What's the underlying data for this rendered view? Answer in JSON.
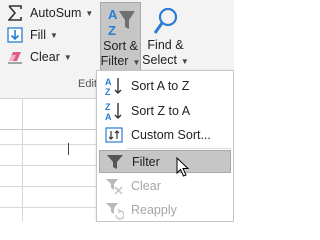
{
  "ribbon": {
    "autosum": {
      "label": "AutoSum",
      "icon": "sigma-icon"
    },
    "fill": {
      "label": "Fill",
      "icon": "fill-down-icon"
    },
    "clear": {
      "label": "Clear",
      "icon": "eraser-icon"
    },
    "sort_filter": {
      "label_line1": "Sort &",
      "label_line2": "Filter",
      "icon": "sort-filter-icon"
    },
    "find_select": {
      "label_line1": "Find &",
      "label_line2": "Select",
      "icon": "magnifier-icon"
    },
    "group_label": "Editi",
    "accent_color": "#2b7cd3"
  },
  "menu": {
    "items": [
      {
        "label": "Sort A to Z",
        "icon": "sort-a-to-z-icon",
        "enabled": true
      },
      {
        "label": "Sort Z to A",
        "icon": "sort-z-to-a-icon",
        "enabled": true
      },
      {
        "label": "Custom Sort...",
        "icon": "custom-sort-icon",
        "enabled": true
      },
      {
        "label": "Filter",
        "icon": "filter-funnel-icon",
        "enabled": true,
        "highlighted": true
      },
      {
        "label": "Clear",
        "icon": "clear-filter-icon",
        "enabled": false
      },
      {
        "label": "Reapply",
        "icon": "reapply-filter-icon",
        "enabled": false
      }
    ]
  }
}
